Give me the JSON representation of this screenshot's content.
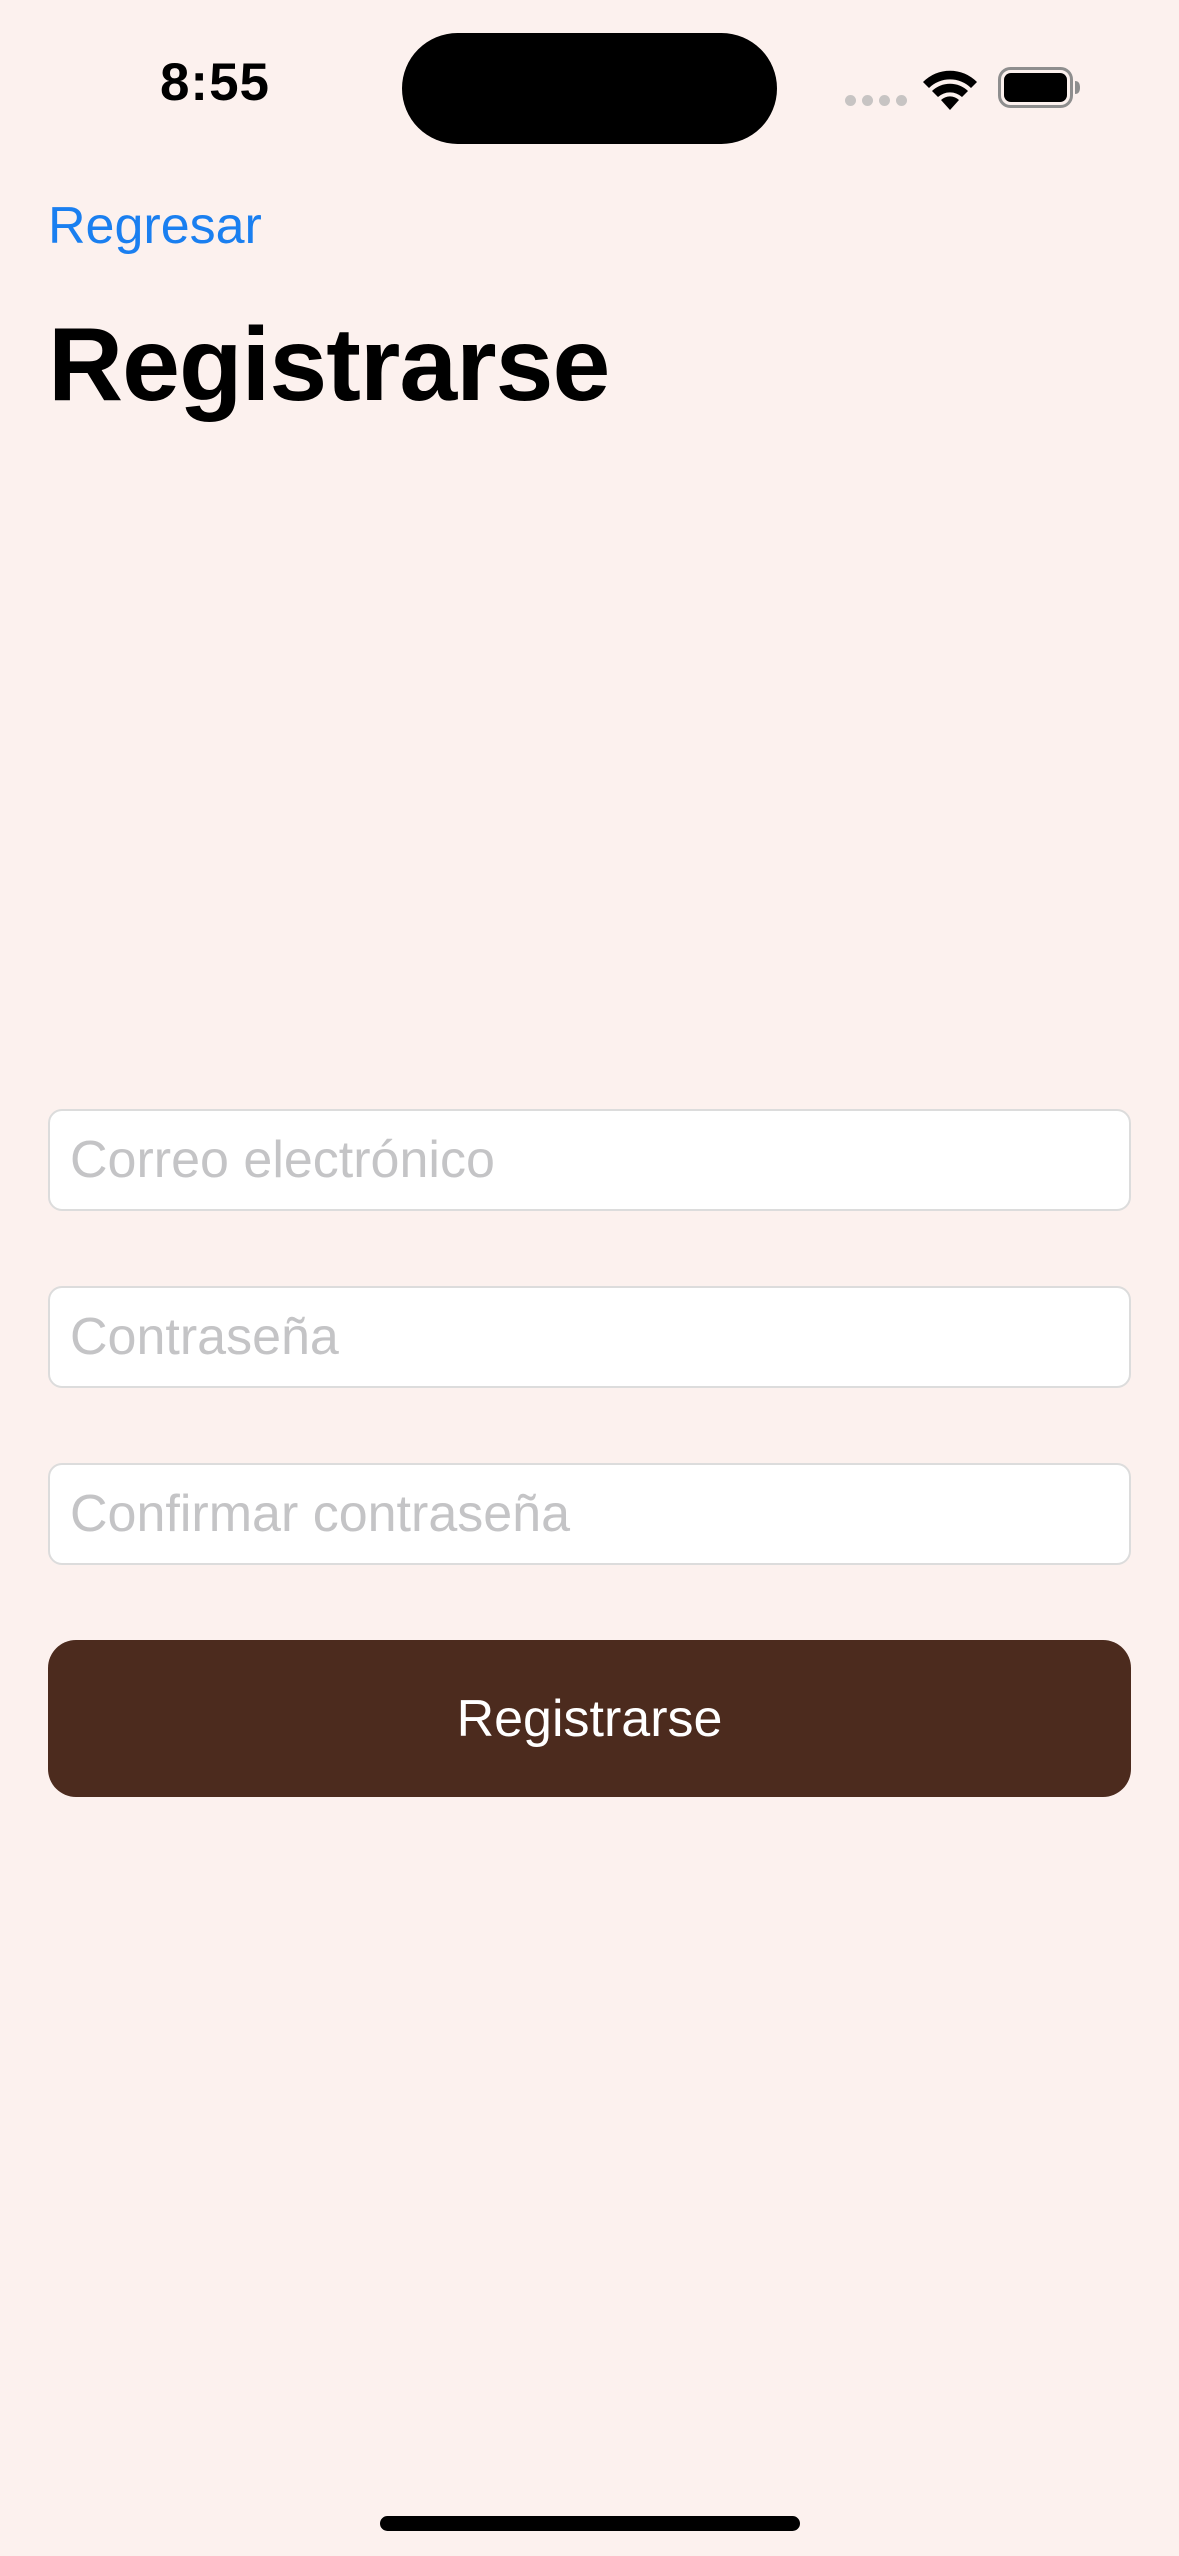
{
  "status_bar": {
    "time": "8:55"
  },
  "header": {
    "back_label": "Regresar",
    "title": "Registrarse"
  },
  "form": {
    "email_placeholder": "Correo electrónico",
    "email_value": "",
    "password_placeholder": "Contraseña",
    "password_value": "",
    "confirm_placeholder": "Confirmar contraseña",
    "confirm_value": "",
    "submit_label": "Registrarse"
  },
  "theme": {
    "background": "#fcf1ee",
    "accent": "#1a7ff0",
    "button": "#4c2b1e"
  },
  "icons": {
    "wifi": "wifi-icon",
    "battery": "battery-icon",
    "signal": "signal-icon"
  }
}
